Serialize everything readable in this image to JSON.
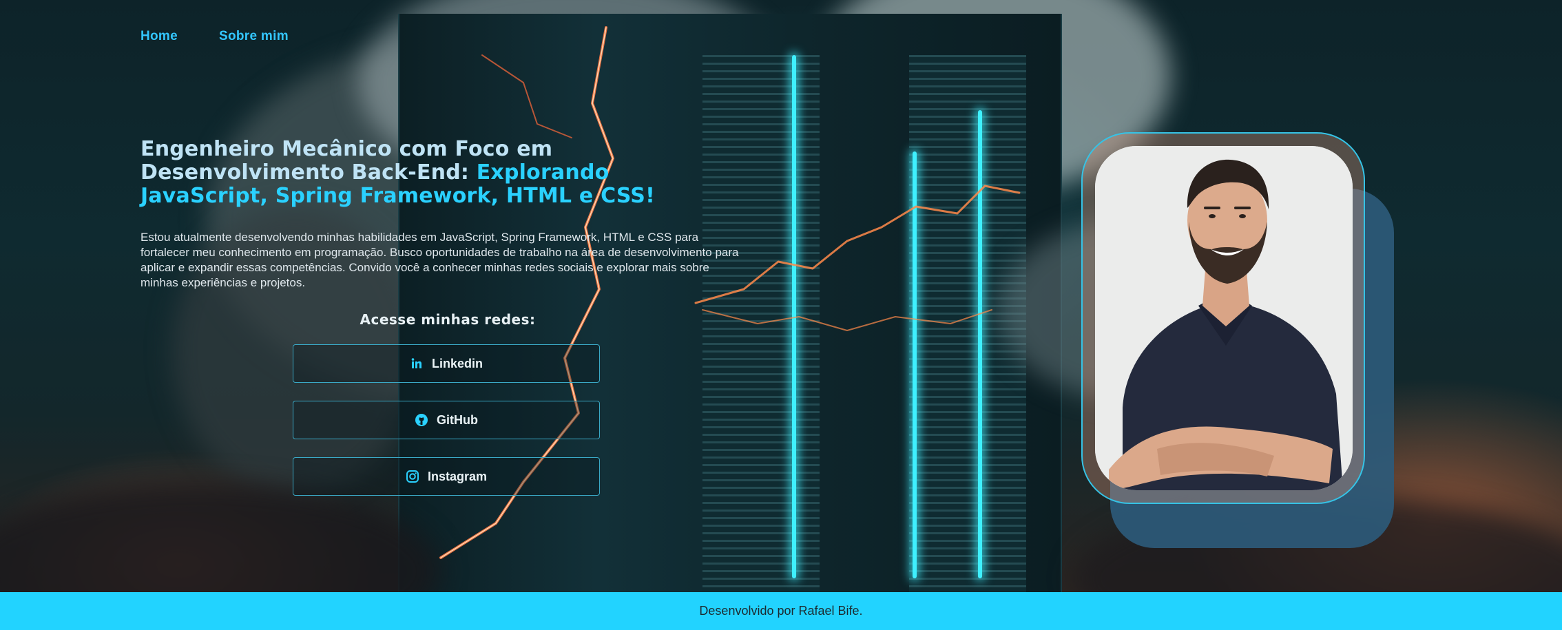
{
  "nav": {
    "items": [
      {
        "label": "Home"
      },
      {
        "label": "Sobre mim"
      }
    ]
  },
  "hero": {
    "title_part1": "Engenheiro Mecânico com Foco em Desenvolvimento Back-End: ",
    "title_accent": "Explorando JavaScript, Spring Framework, HTML e CSS!",
    "description": "Estou atualmente desenvolvendo minhas habilidades em JavaScript, Spring Framework, HTML e CSS para fortalecer meu conhecimento em programação. Busco oportunidades de trabalho na área de desenvolvimento para aplicar e expandir essas competências. Convido você a conhecer minhas redes sociais e explorar mais sobre minhas experiências e projetos."
  },
  "socials": {
    "title": "Acesse minhas redes:",
    "buttons": [
      {
        "label": "Linkedin",
        "icon": "linkedin-icon"
      },
      {
        "label": "GitHub",
        "icon": "github-icon"
      },
      {
        "label": "Instagram",
        "icon": "instagram-icon"
      }
    ]
  },
  "footer": {
    "text": "Desenvolvido por Rafael Bife."
  },
  "colors": {
    "accent": "#2ad1ff",
    "nav_link": "#33c6ff",
    "footer_bg": "#22d3ff",
    "photo_shadow": "#2d5a7a",
    "button_border": "#3aa9c6"
  }
}
